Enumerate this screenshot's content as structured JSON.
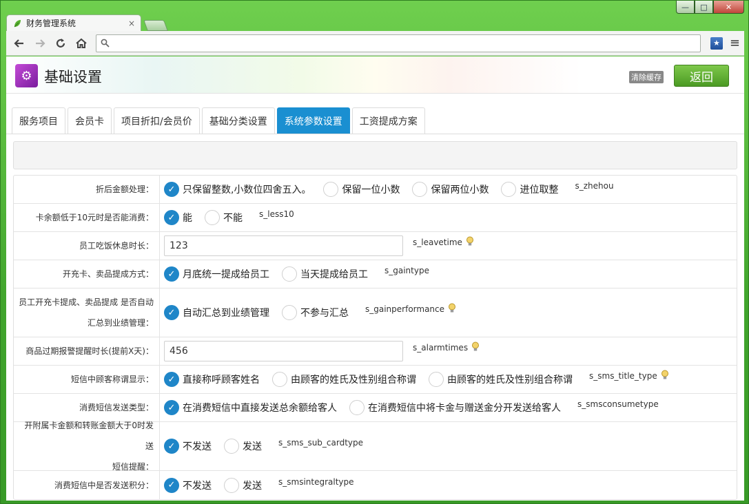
{
  "browser": {
    "tab_title": "财务管理系统",
    "tab_close": "×",
    "address_value": "",
    "win_min": "—",
    "win_max": "□",
    "win_close": "✕",
    "icons": [
      "back-arrow-icon",
      "forward-arrow-icon",
      "reload-icon",
      "home-icon",
      "search-icon",
      "bookmark-icon",
      "menu-icon"
    ]
  },
  "header": {
    "title": "基础设置",
    "clear_cache": "清除缓存",
    "back_label": "返回"
  },
  "tabs": [
    {
      "label": "服务项目",
      "active": false
    },
    {
      "label": "会员卡",
      "active": false
    },
    {
      "label": "项目折扣/会员价",
      "active": false
    },
    {
      "label": "基础分类设置",
      "active": false
    },
    {
      "label": "系统参数设置",
      "active": true
    },
    {
      "label": "工资提成方案",
      "active": false
    }
  ],
  "settings": {
    "zhehou": {
      "label": "折后金额处理：",
      "options": [
        "只保留整数,小数位四舍五入。",
        "保留一位小数",
        "保留两位小数",
        "进位取整"
      ],
      "selected": 0,
      "code": "s_zhehou"
    },
    "less10": {
      "label": "卡余额低于10元时是否能消费：",
      "options": [
        "能",
        "不能"
      ],
      "selected": 0,
      "code": "s_less10"
    },
    "leavetime": {
      "label": "员工吃饭休息时长：",
      "value": "123",
      "code": "s_leavetime"
    },
    "gaintype": {
      "label": "开充卡、卖品提成方式：",
      "options": [
        "月底统一提成给员工",
        "当天提成给员工"
      ],
      "selected": 0,
      "code": "s_gaintype"
    },
    "gainperformance": {
      "label_line1": "员工开充卡提成、卖品提成 是否自动",
      "label_line2": "汇总到业绩管理：",
      "options": [
        "自动汇总到业绩管理",
        "不参与汇总"
      ],
      "selected": 0,
      "code": "s_gainperformance"
    },
    "alarmtimes": {
      "label": "商品过期报警提醒时长(提前X天)：",
      "value": "456",
      "code": "s_alarmtimes"
    },
    "sms_title_type": {
      "label": "短信中顾客称谓显示：",
      "options": [
        "直接称呼顾客姓名",
        "由顾客的姓氏及性别组合称谓",
        "由顾客的姓氏及性别组合称谓"
      ],
      "selected": 0,
      "code": "s_sms_title_type"
    },
    "smsconsumetype": {
      "label": "消费短信发送类型：",
      "options": [
        "在消费短信中直接发送总余额给客人",
        "在消费短信中将卡金与赠送金分开发送给客人"
      ],
      "selected": 0,
      "code": "s_smsconsumetype"
    },
    "sms_sub_cardtype": {
      "label_line1": "开附属卡金额和转账金额大于0时发送",
      "label_line2": "短信提醒：",
      "options": [
        "不发送",
        "发送"
      ],
      "selected": 0,
      "code": "s_sms_sub_cardtype"
    },
    "smsintegraltype": {
      "label": "消费短信中是否发送积分：",
      "options": [
        "不发送",
        "发送"
      ],
      "selected": 0,
      "code": "s_smsintegraltype"
    }
  },
  "colors": {
    "accent_blue": "#1a8fd1",
    "back_green": "#5aab2d",
    "frame_green": "#41a52d"
  }
}
